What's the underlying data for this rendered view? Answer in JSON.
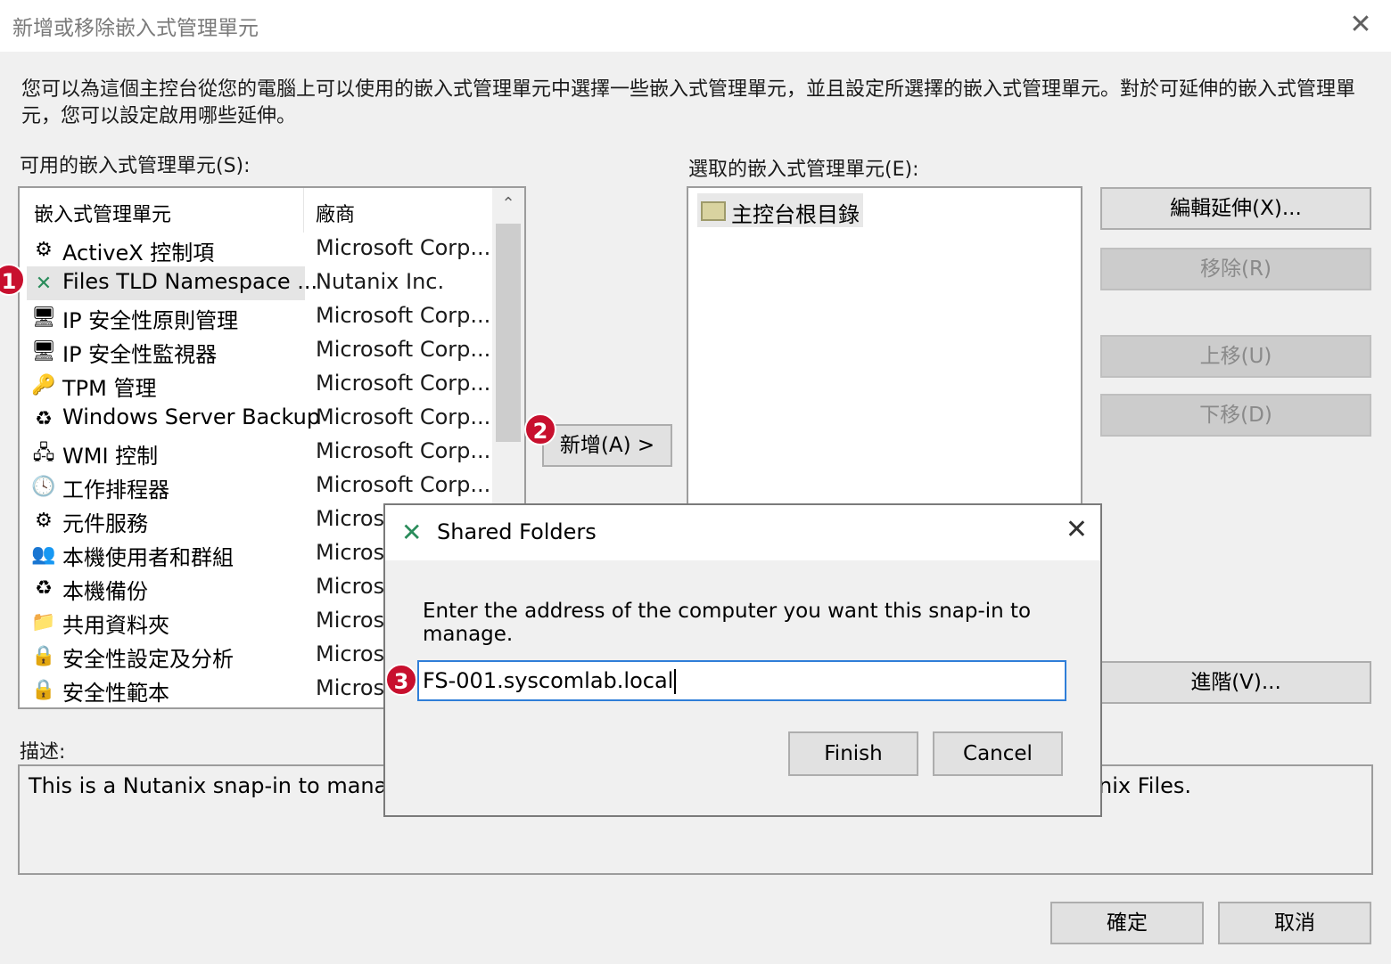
{
  "window": {
    "title": "新增或移除嵌入式管理單元",
    "close_glyph": "✕"
  },
  "intro": "您可以為這個主控台從您的電腦上可以使用的嵌入式管理單元中選擇一些嵌入式管理單元，並且設定所選擇的嵌入式管理單元。對於可延伸的嵌入式管理單元，您可以設定啟用哪些延伸。",
  "available": {
    "label": "可用的嵌入式管理單元(S):",
    "col_name": "嵌入式管理單元",
    "col_vendor": "廠商",
    "items": [
      {
        "name": "ActiveX 控制項",
        "vendor": "Microsoft Corp...",
        "icon": "activex-icon",
        "glyph": "⚙"
      },
      {
        "name": "Files TLD Namespace ...",
        "vendor": "Nutanix Inc.",
        "icon": "nutanix-icon",
        "glyph": "✕",
        "selected": true
      },
      {
        "name": "IP 安全性原則管理",
        "vendor": "Microsoft Corp...",
        "icon": "ip-security-policy-icon",
        "glyph": "🖥"
      },
      {
        "name": "IP 安全性監視器",
        "vendor": "Microsoft Corp...",
        "icon": "ip-security-monitor-icon",
        "glyph": "🖥"
      },
      {
        "name": "TPM 管理",
        "vendor": "Microsoft Corp...",
        "icon": "tpm-icon",
        "glyph": "🔑"
      },
      {
        "name": "Windows Server Backup",
        "vendor": "Microsoft Corp...",
        "icon": "server-backup-icon",
        "glyph": "♻"
      },
      {
        "name": "WMI 控制",
        "vendor": "Microsoft Corp...",
        "icon": "wmi-icon",
        "glyph": "🖧"
      },
      {
        "name": "工作排程器",
        "vendor": "Microsoft Corp...",
        "icon": "clock-icon",
        "glyph": "🕓"
      },
      {
        "name": "元件服務",
        "vendor": "Micros",
        "icon": "component-services-icon",
        "glyph": "⚙"
      },
      {
        "name": "本機使用者和群組",
        "vendor": "Micros",
        "icon": "users-groups-icon",
        "glyph": "👥"
      },
      {
        "name": "本機備份",
        "vendor": "Micros",
        "icon": "local-backup-icon",
        "glyph": "♻"
      },
      {
        "name": "共用資料夾",
        "vendor": "Micros",
        "icon": "shared-folder-icon",
        "glyph": "📁"
      },
      {
        "name": "安全性設定及分析",
        "vendor": "Micros",
        "icon": "security-analysis-icon",
        "glyph": "🔒"
      },
      {
        "name": "安全性範本",
        "vendor": "Micros",
        "icon": "security-template-icon",
        "glyph": "🔒"
      }
    ]
  },
  "add_button": "新增(A) >",
  "selected": {
    "label": "選取的嵌入式管理單元(E):",
    "items": [
      {
        "name": "主控台根目錄",
        "icon": "folder-icon"
      }
    ]
  },
  "side_buttons": {
    "edit_ext": "編輯延伸(X)...",
    "remove": "移除(R)",
    "move_up": "上移(U)",
    "move_down": "下移(D)",
    "advanced": "進階(V)..."
  },
  "description": {
    "label": "描述:",
    "text_left": "This is a Nutanix snap-in to manage",
    "text_right": "nix Files."
  },
  "footer": {
    "ok": "確定",
    "cancel": "取消"
  },
  "badges": [
    "1",
    "2",
    "3"
  ],
  "modal": {
    "title": "Shared Folders",
    "close_glyph": "✕",
    "message": "Enter the address of the computer you want this snap-in to manage.",
    "input_value": "FS-001.syscomlab.local",
    "finish": "Finish",
    "cancel": "Cancel"
  },
  "colors": {
    "badge": "#c8102e",
    "input_focus": "#2f7ed8",
    "nutanix": "#2a8c5b"
  }
}
